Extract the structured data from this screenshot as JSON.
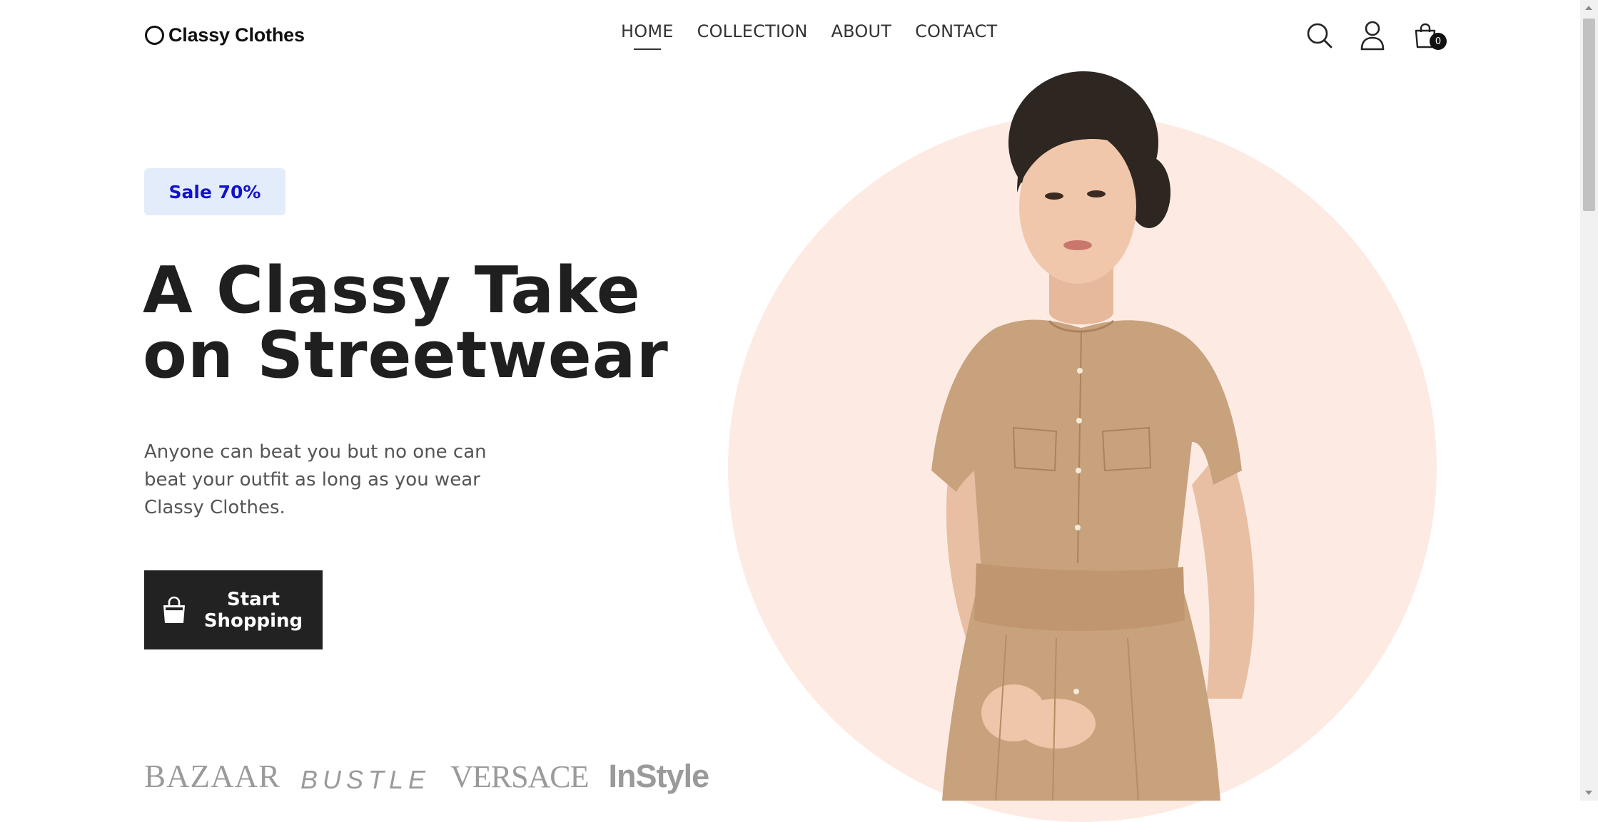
{
  "header": {
    "logo_text": "Classy Clothes",
    "nav": [
      {
        "label": "HOME",
        "active": true
      },
      {
        "label": "COLLECTION",
        "active": false
      },
      {
        "label": "ABOUT",
        "active": false
      },
      {
        "label": "CONTACT",
        "active": false
      }
    ],
    "icons": [
      "search-icon",
      "user-icon",
      "cart-icon"
    ],
    "cart_count": "0"
  },
  "hero": {
    "badge": "Sale 70%",
    "title_line1": "A Classy Take",
    "title_line2": "on Streetwear",
    "description": "Anyone can beat you but no one can beat your outfit as long as you wear Classy Clothes.",
    "cta_line1": "Start",
    "cta_line2": "Shopping",
    "cta_icon": "shopping-bag-icon"
  },
  "brands": [
    "BAZAAR",
    "BUSTLE",
    "VERSACE",
    "InStyle"
  ],
  "colors": {
    "accent_badge_bg": "#e3ecfb",
    "accent_badge_text": "#1212c8",
    "circle": "#fdebe3",
    "button": "#222222",
    "dress": "#c8a27c"
  }
}
